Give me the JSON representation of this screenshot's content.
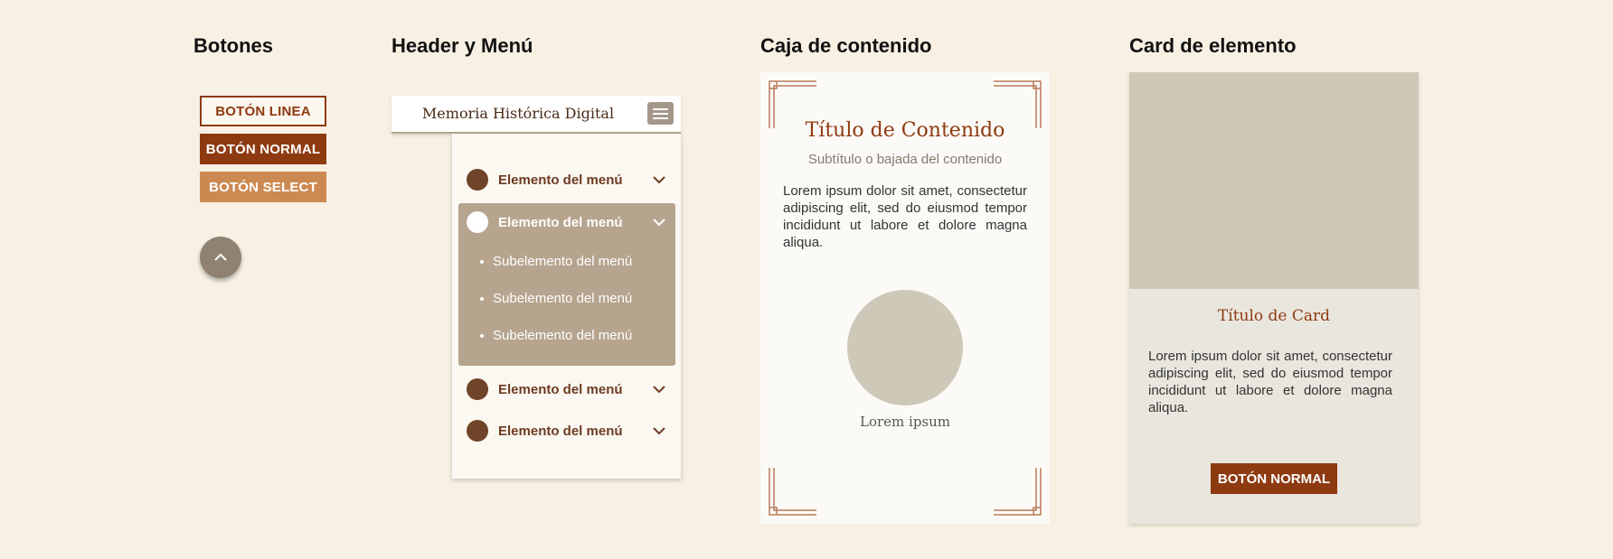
{
  "sections": {
    "buttons_title": "Botones",
    "header_menu_title": "Header y Menú",
    "content_box_title": "Caja de contenido",
    "card_title": "Card de elemento"
  },
  "buttons": {
    "outline_label": "BOTÓN LINEA",
    "normal_label": "BOTÓN NORMAL",
    "select_label": "BOTÓN SELECT"
  },
  "header": {
    "site_title": "Memoria Histórica Digital"
  },
  "menu": {
    "items": [
      {
        "label": "Elemento del menú"
      },
      {
        "label": "Elemento del menú"
      },
      {
        "label": "Elemento del menú"
      },
      {
        "label": "Elemento del menú"
      }
    ],
    "subitems": [
      {
        "label": "Subelemento del menú"
      },
      {
        "label": "Subelemento del menú"
      },
      {
        "label": "Subelemento del menú"
      }
    ]
  },
  "content_box": {
    "title": "Título de Contenido",
    "subtitle": "Subtítulo o bajada del contenido",
    "body": "Lorem ipsum dolor sit amet, consectetur adipiscing elit, sed do eiusmod tempor incididunt ut labore et dolore magna aliqua.",
    "caption": "Lorem ipsum"
  },
  "card": {
    "title": "Título de Card",
    "body": "Lorem ipsum dolor sit amet, consectetur adipiscing elit, sed do eiusmod tempor incididunt ut labore et dolore magna aliqua.",
    "button_label": "BOTÓN NORMAL"
  },
  "colors": {
    "background": "#f7f0e3",
    "primary": "#8e3a10",
    "accent": "#cc8a52",
    "menu_open_bg": "#b6a48e",
    "placeholder": "#cdc8b8"
  },
  "icons": {
    "scroll_top": "chevron-up-icon",
    "menu": "hamburger-icon",
    "expand": "chevron-down-icon"
  }
}
